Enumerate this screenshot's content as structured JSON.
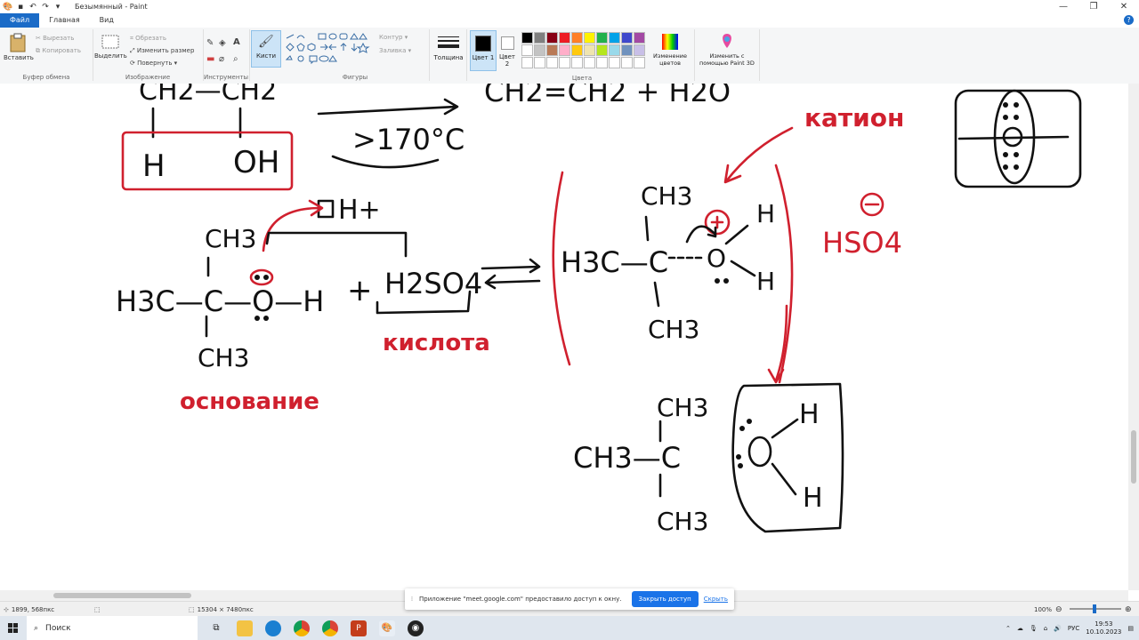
{
  "window": {
    "title": "Безымянный - Paint",
    "controls": [
      "—",
      "❐",
      "✕"
    ]
  },
  "tabs": [
    "Файл",
    "Главная",
    "Вид"
  ],
  "ribbon": {
    "clipboard": {
      "paste": "Вставить",
      "cut": "Вырезать",
      "copy": "Копировать",
      "label": "Буфер обмена"
    },
    "image": {
      "select": "Выделить",
      "crop": "Обрезать",
      "resize": "Изменить размер",
      "rotate": "Повернуть",
      "label": "Изображение"
    },
    "tools": {
      "label": "Инструменты"
    },
    "brushes": {
      "label": "Кисти"
    },
    "shapes": {
      "outline": "Контур",
      "fill": "Заливка",
      "label": "Фигуры"
    },
    "size": {
      "label": "Толщина"
    },
    "colors": {
      "color1": "Цвет 1",
      "color2": "Цвет 2",
      "edit": "Изменение цветов",
      "label": "Цвета",
      "palette": [
        "#000000",
        "#7f7f7f",
        "#880015",
        "#ed1c24",
        "#ff7f27",
        "#fff200",
        "#22b14c",
        "#00a2e8",
        "#3f48cc",
        "#a349a4",
        "#ffffff",
        "#c3c3c3",
        "#b97a57",
        "#ffaec9",
        "#ffc90e",
        "#efe4b0",
        "#b5e61d",
        "#99d9ea",
        "#7092be",
        "#c8bfe7",
        "#ffffff",
        "#ffffff",
        "#ffffff",
        "#ffffff",
        "#ffffff",
        "#ffffff",
        "#ffffff",
        "#ffffff",
        "#ffffff",
        "#ffffff"
      ]
    },
    "paint3d": "Изменить с помощью Paint 3D"
  },
  "drawing": {
    "t_ch2_left": "CH2—CH2",
    "t_h": "H",
    "t_oh": "OH",
    "t_temp": ">170°C",
    "t_ethylene": "CH2=CH2 + H2O",
    "t_kation": "катион",
    "t_hplus": "H+",
    "t_ch3_top": "CH3",
    "t_h3c": "H3C—C—O—H",
    "t_ch3_bottom": "CH3",
    "t_plus": "+",
    "t_h2so4": "H2SO4",
    "t_kislota": "кислота",
    "t_osnovanie": "основание",
    "t_ch3_cation_top": "CH3",
    "t_h3c_cation": "H3C—C",
    "t_ch3_cation_bottom": "CH3",
    "t_h_right1": "H",
    "t_h_right2": "H",
    "t_hso4": "HSO4",
    "t_ch3_carbo_top": "CH3",
    "t_ch3_carbo": "CH3—C",
    "t_ch3_carbo_bottom": "CH3",
    "t_water_h1": "H",
    "t_water_h2": "H"
  },
  "share": {
    "message": "Приложение \"meet.google.com\" предоставило доступ к окну.",
    "stop": "Закрыть доступ",
    "hide": "Скрыть"
  },
  "status": {
    "cursor": "1899, 568пкс",
    "canvas_size": "15304 × 7480пкс",
    "zoom": "100%"
  },
  "taskbar": {
    "search": "Поиск",
    "lang": "РУС",
    "time": "19:53",
    "date": "10.10.2023"
  }
}
